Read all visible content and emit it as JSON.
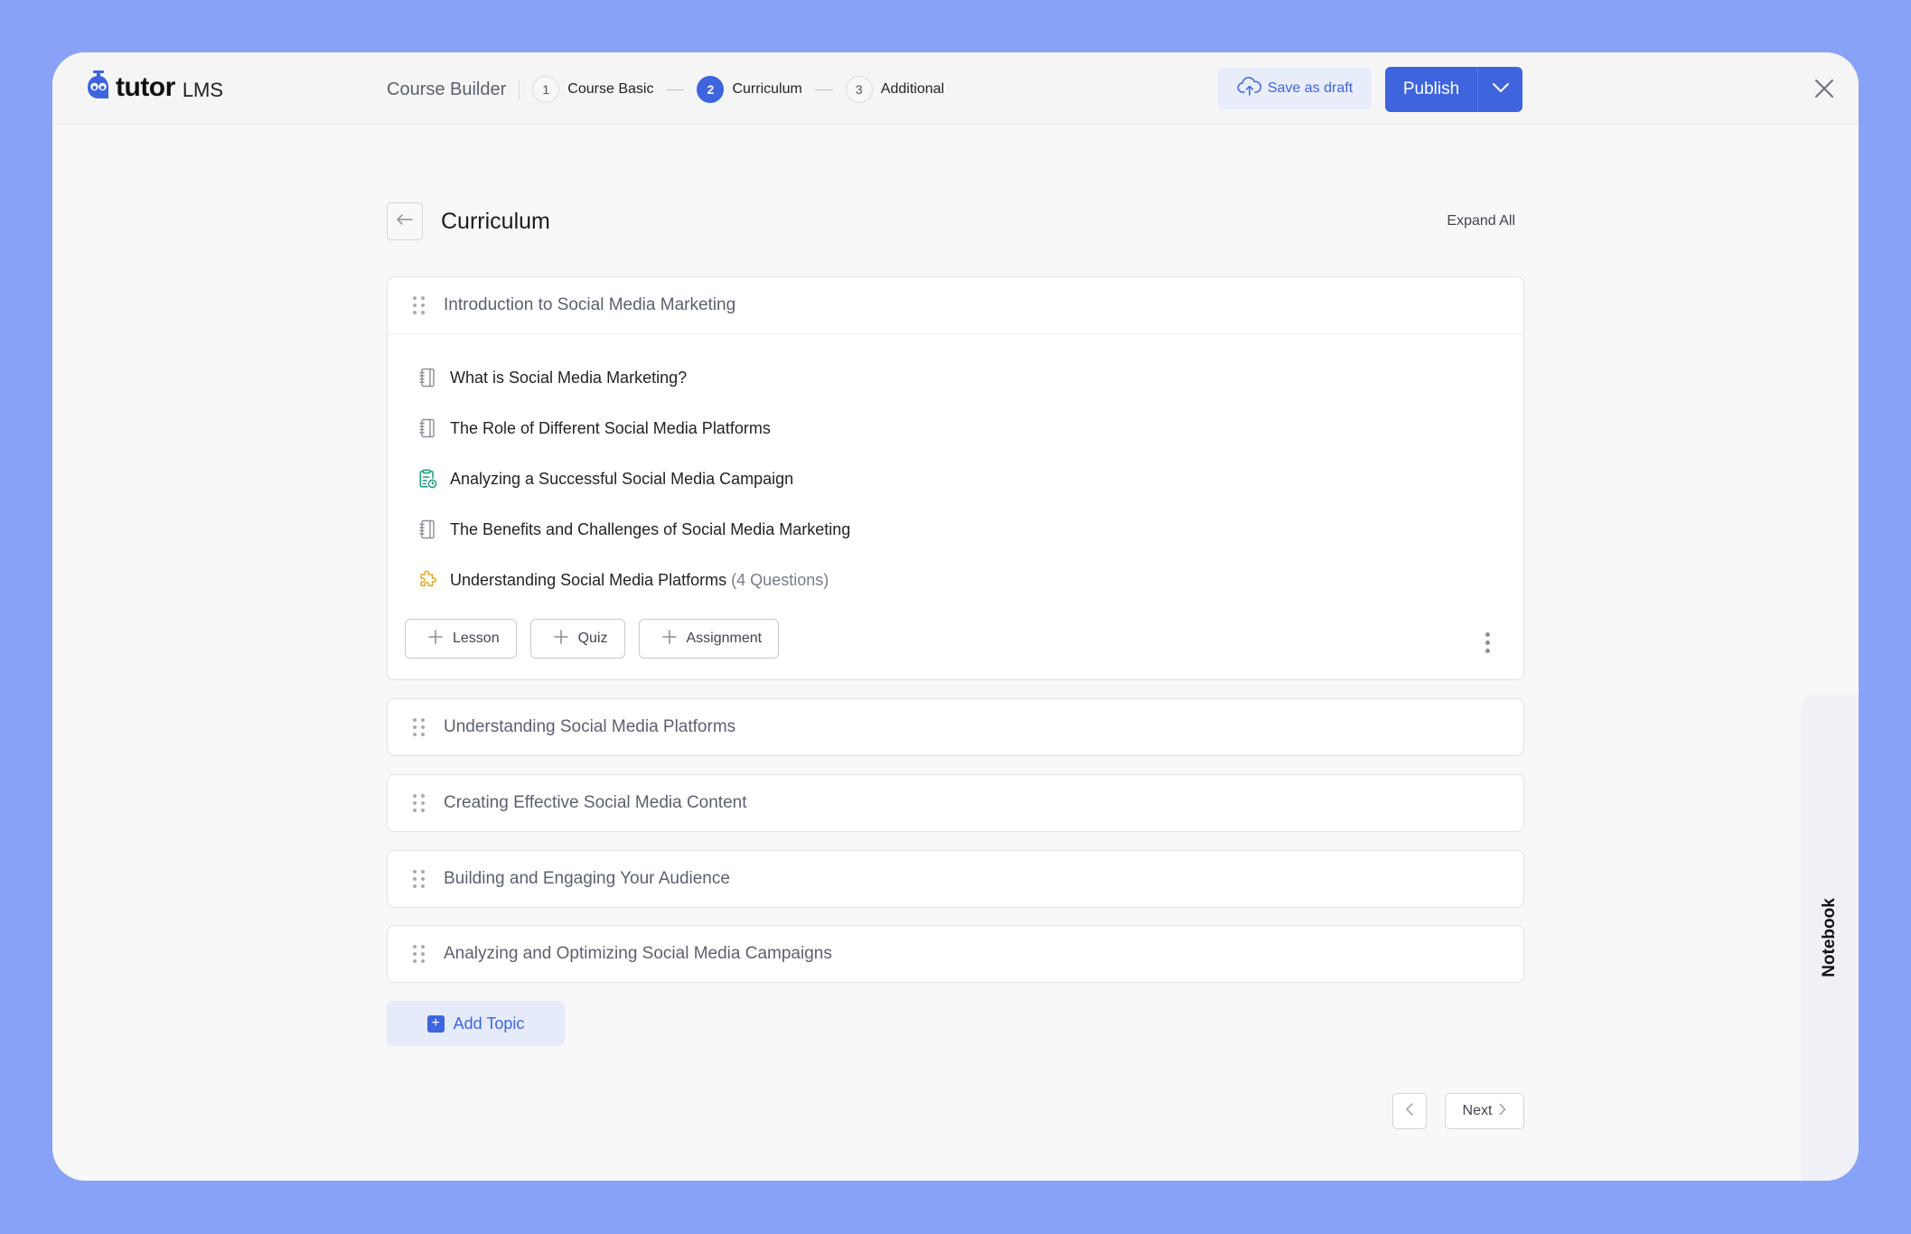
{
  "app": {
    "logo_text": "tutor",
    "logo_sub": "LMS",
    "logo_icon": "owl-logo-icon"
  },
  "header": {
    "builder_title": "Course Builder",
    "steps": [
      {
        "number": "1",
        "label": "Course Basic",
        "active": false
      },
      {
        "number": "2",
        "label": "Curriculum",
        "active": true
      },
      {
        "number": "3",
        "label": "Additional",
        "active": false
      }
    ],
    "save_draft_label": "Save as draft",
    "save_draft_icon": "cloud-upload-icon",
    "publish_label": "Publish",
    "publish_menu_icon": "chevron-down-icon",
    "close_icon": "close-icon"
  },
  "page": {
    "title": "Curriculum",
    "back_icon": "arrow-left-icon",
    "expand_all_label": "Expand All"
  },
  "topics": [
    {
      "title": "Introduction to Social Media Marketing",
      "expanded": true,
      "items": [
        {
          "type": "lesson",
          "icon": "lesson-book-icon",
          "label": "What is Social Media Marketing?",
          "extra": ""
        },
        {
          "type": "lesson",
          "icon": "lesson-book-icon",
          "label": "The Role of Different Social Media Platforms",
          "extra": ""
        },
        {
          "type": "assignment",
          "icon": "assignment-clipboard-icon",
          "label": "Analyzing a Successful Social Media Campaign",
          "extra": ""
        },
        {
          "type": "lesson",
          "icon": "lesson-book-icon",
          "label": "The Benefits and Challenges of Social Media Marketing",
          "extra": ""
        },
        {
          "type": "quiz",
          "icon": "quiz-puzzle-icon",
          "label": "Understanding Social Media Platforms",
          "extra": "(4 Questions)"
        }
      ],
      "add_buttons": [
        "Lesson",
        "Quiz",
        "Assignment"
      ]
    },
    {
      "title": "Understanding Social Media Platforms",
      "expanded": false
    },
    {
      "title": "Creating Effective Social Media Content",
      "expanded": false
    },
    {
      "title": "Building and Engaging Your Audience",
      "expanded": false
    },
    {
      "title": "Analyzing and Optimizing Social Media Campaigns",
      "expanded": false
    }
  ],
  "add_topic_label": "Add Topic",
  "pagination": {
    "next_label": "Next"
  },
  "notebook_label": "Notebook",
  "colors": {
    "accent": "#3e64de",
    "background": "#87a2f6",
    "assignment_icon": "#1a9d7a",
    "quiz_icon": "#e6a41e"
  }
}
